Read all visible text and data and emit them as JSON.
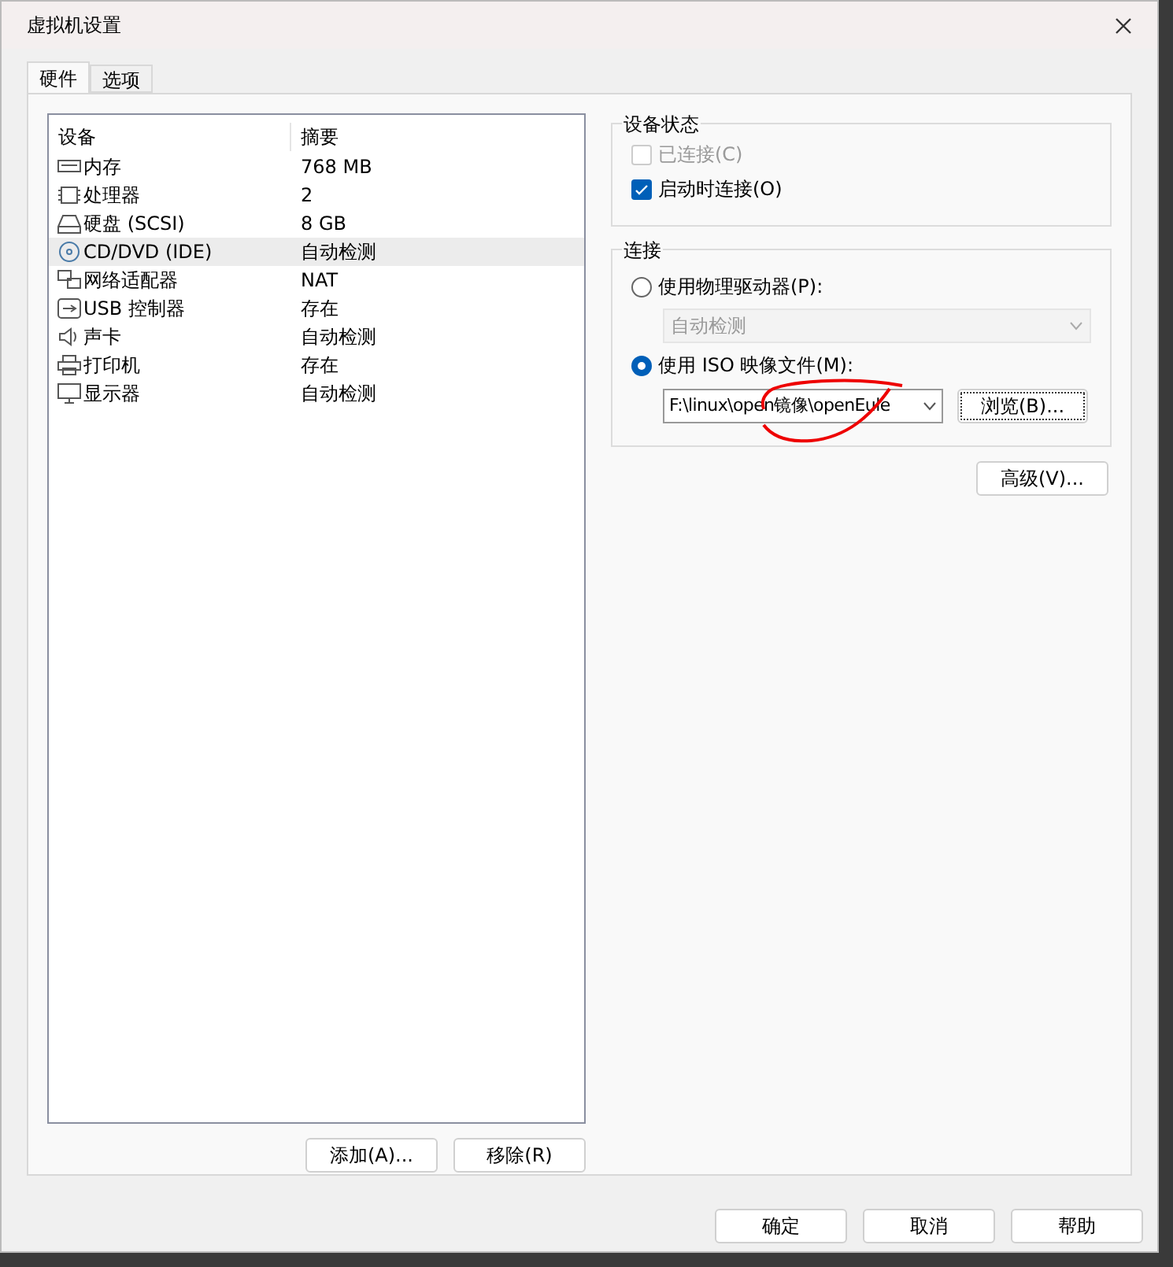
{
  "window": {
    "title": "虚拟机设置"
  },
  "tabs": [
    {
      "label": "硬件",
      "selected": true
    },
    {
      "label": "选项",
      "selected": false
    }
  ],
  "device_table": {
    "columns": [
      "设备",
      "摘要"
    ],
    "rows": [
      {
        "kind": "memory",
        "device": "内存",
        "summary": "768 MB",
        "selected": false
      },
      {
        "kind": "cpu",
        "device": "处理器",
        "summary": "2",
        "selected": false
      },
      {
        "kind": "disk",
        "device": "硬盘 (SCSI)",
        "summary": "8 GB",
        "selected": false
      },
      {
        "kind": "cd",
        "device": "CD/DVD (IDE)",
        "summary": "自动检测",
        "selected": true
      },
      {
        "kind": "network",
        "device": "网络适配器",
        "summary": "NAT",
        "selected": false
      },
      {
        "kind": "usb",
        "device": "USB 控制器",
        "summary": "存在",
        "selected": false
      },
      {
        "kind": "sound",
        "device": "声卡",
        "summary": "自动检测",
        "selected": false
      },
      {
        "kind": "printer",
        "device": "打印机",
        "summary": "存在",
        "selected": false
      },
      {
        "kind": "display",
        "device": "显示器",
        "summary": "自动检测",
        "selected": false
      }
    ]
  },
  "list_buttons": [
    "添加(A)...",
    "移除(R)"
  ],
  "device_status": {
    "title": "设备状态",
    "options": [
      {
        "label": "已连接(C)",
        "checked": false,
        "disabled": true
      },
      {
        "label": "启动时连接(O)",
        "checked": true,
        "disabled": false
      }
    ]
  },
  "connection": {
    "title": "连接",
    "physical": {
      "label": "使用物理驱动器(P):",
      "selected": false,
      "drive": {
        "value": "自动检测",
        "disabled": true
      }
    },
    "iso": {
      "label": "使用 ISO 映像文件(M):",
      "selected": true,
      "path": "F:\\linux\\open镜像\\openEule",
      "browse": "浏览(B)..."
    }
  },
  "advanced_button": "高级(V)...",
  "footer_buttons": [
    "确定",
    "取消",
    "帮助"
  ]
}
